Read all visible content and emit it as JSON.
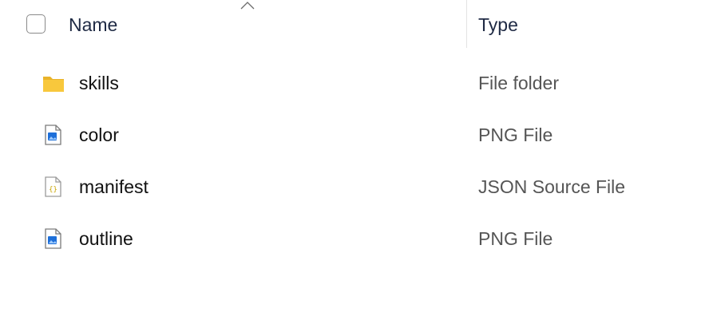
{
  "header": {
    "name_label": "Name",
    "type_label": "Type",
    "sort_icon": "chevron-up-icon"
  },
  "files": [
    {
      "name": "skills",
      "type": "File folder",
      "icon": "folder-icon"
    },
    {
      "name": "color",
      "type": "PNG File",
      "icon": "png-file-icon"
    },
    {
      "name": "manifest",
      "type": "JSON Source File",
      "icon": "json-file-icon"
    },
    {
      "name": "outline",
      "type": "PNG File",
      "icon": "png-file-icon"
    }
  ],
  "colors": {
    "folder": "#F8C83C",
    "image_accent": "#1E6FD9",
    "json_accent": "#C9A400"
  }
}
